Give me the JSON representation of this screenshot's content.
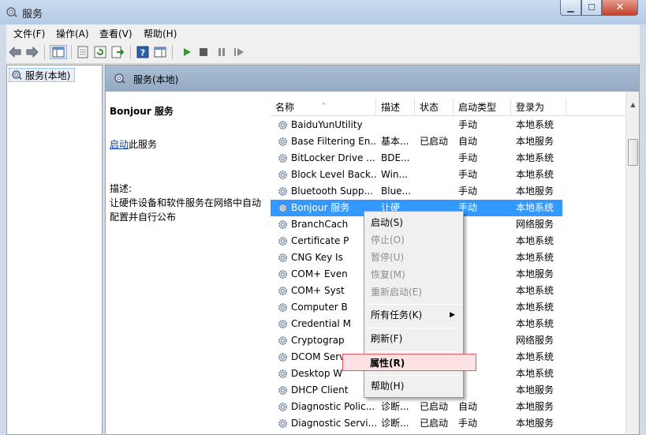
{
  "window": {
    "title": "服务"
  },
  "menubar": {
    "items": [
      "文件(F)",
      "操作(A)",
      "查看(V)",
      "帮助(H)"
    ]
  },
  "tree": {
    "item": "服务(本地)"
  },
  "pane": {
    "header": "服务(本地)"
  },
  "detail": {
    "service_name": "Bonjour 服务",
    "start_link": "启动",
    "start_suffix": "此服务",
    "desc_label": "描述:",
    "desc_text": "让硬件设备和软件服务在网络中自动配置并自行公布"
  },
  "columns": [
    "名称",
    "描述",
    "状态",
    "启动类型",
    "登录为"
  ],
  "services": [
    {
      "name": "BaiduYunUtility",
      "desc": "",
      "status": "",
      "start": "手动",
      "logon": "本地系统"
    },
    {
      "name": "Base Filtering En...",
      "desc": "基本...",
      "status": "已启动",
      "start": "自动",
      "logon": "本地服务"
    },
    {
      "name": "BitLocker Drive ...",
      "desc": "BDE...",
      "status": "",
      "start": "手动",
      "logon": "本地系统"
    },
    {
      "name": "Block Level Back...",
      "desc": "Win...",
      "status": "",
      "start": "手动",
      "logon": "本地系统"
    },
    {
      "name": "Bluetooth Supp...",
      "desc": "Blue...",
      "status": "",
      "start": "手动",
      "logon": "本地服务"
    },
    {
      "name": "Bonjour 服务",
      "desc": "让硬",
      "status": "",
      "start": "手动",
      "logon": "本地系统"
    },
    {
      "name": "BranchCach",
      "desc": "",
      "status": "",
      "start": "",
      "logon": "网络服务"
    },
    {
      "name": "Certificate P",
      "desc": "",
      "status": "",
      "start": "",
      "logon": "本地系统"
    },
    {
      "name": "CNG Key Is",
      "desc": "",
      "status": "",
      "start": "",
      "logon": "本地系统"
    },
    {
      "name": "COM+ Even",
      "desc": "",
      "status": "",
      "start": "",
      "logon": "本地服务"
    },
    {
      "name": "COM+ Syst",
      "desc": "",
      "status": "",
      "start": "",
      "logon": "本地系统"
    },
    {
      "name": "Computer B",
      "desc": "",
      "status": "",
      "start": "",
      "logon": "本地系统"
    },
    {
      "name": "Credential M",
      "desc": "",
      "status": "",
      "start": "",
      "logon": "本地系统"
    },
    {
      "name": "Cryptograp",
      "desc": "",
      "status": "",
      "start": "",
      "logon": "网络服务"
    },
    {
      "name": "DCOM Serv",
      "desc": "",
      "status": "",
      "start": "",
      "logon": "本地系统"
    },
    {
      "name": "Desktop W",
      "desc": "",
      "status": "",
      "start": "",
      "logon": "本地系统"
    },
    {
      "name": "DHCP Client",
      "desc": "",
      "status": "",
      "start": "",
      "logon": "本地服务"
    },
    {
      "name": "Diagnostic Polic...",
      "desc": "诊断...",
      "status": "已启动",
      "start": "自动",
      "logon": "本地服务"
    },
    {
      "name": "Diagnostic Servi...",
      "desc": "诊断...",
      "status": "已启动",
      "start": "手动",
      "logon": "本地服务"
    }
  ],
  "context_menu": {
    "start": "启动(S)",
    "stop": "停止(O)",
    "pause": "暂停(U)",
    "resume": "恢复(M)",
    "restart": "重新启动(E)",
    "all_tasks": "所有任务(K)",
    "refresh": "刷新(F)",
    "properties": "属性(R)",
    "help": "帮助(H)"
  },
  "colors": {
    "selection": "#3399ff",
    "link": "#0645ad",
    "highlight_border": "#e5565f"
  }
}
